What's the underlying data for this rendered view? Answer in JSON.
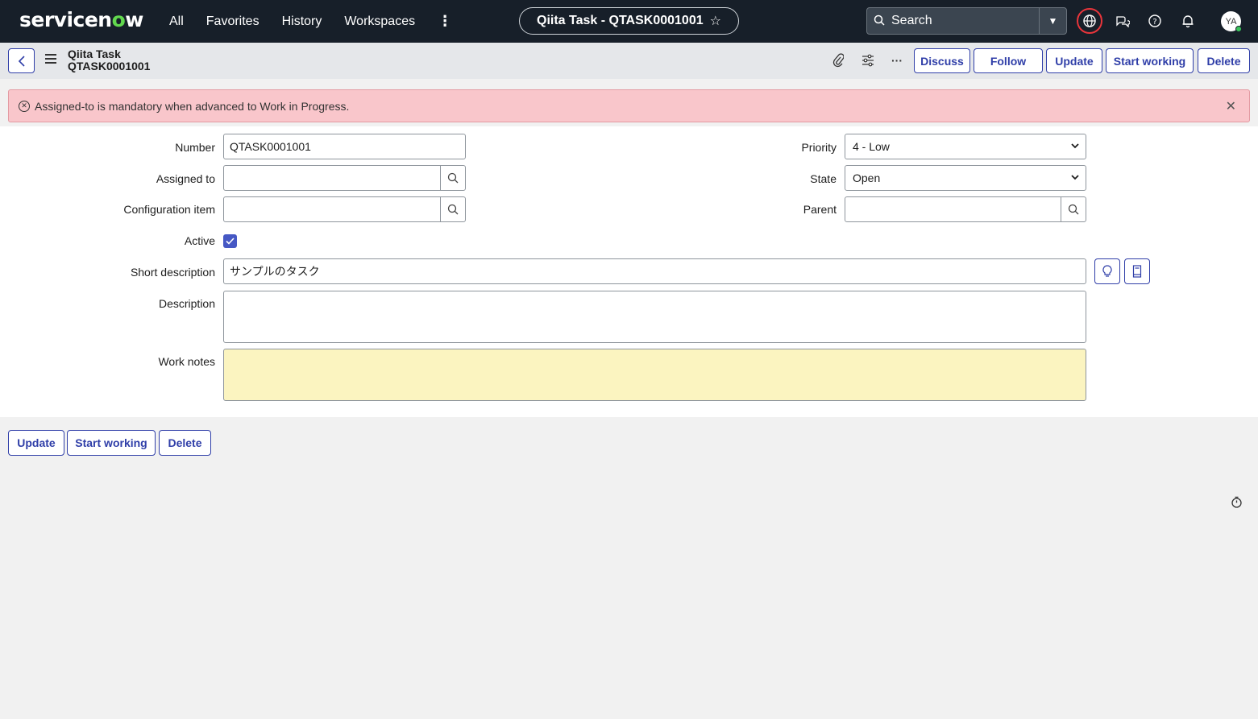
{
  "topnav": {
    "logo_prefix": "servicen",
    "logo_o": "o",
    "logo_suffix": "w",
    "links": [
      "All",
      "Favorites",
      "History",
      "Workspaces"
    ],
    "more_icon": "⋮",
    "context_title": "Qiita Task - QTASK0001001",
    "search_placeholder": "Search",
    "avatar_initials": "YA",
    "icons": [
      "globe-icon",
      "chat-icon",
      "help-icon",
      "bell-icon"
    ]
  },
  "form_header": {
    "table_label": "Qiita Task",
    "record_number": "QTASK0001001",
    "buttons": {
      "discuss": "Discuss",
      "follow": "Follow",
      "update": "Update",
      "start_working": "Start working",
      "delete": "Delete"
    },
    "icons": [
      "paperclip-icon",
      "settings-sliders-icon",
      "more-horizontal-icon"
    ]
  },
  "error": {
    "message": "Assigned-to is mandatory when advanced to Work in Progress."
  },
  "form": {
    "labels": {
      "number": "Number",
      "assigned_to": "Assigned to",
      "configuration_item": "Configuration item",
      "active": "Active",
      "short_description": "Short description",
      "description": "Description",
      "work_notes": "Work notes",
      "priority": "Priority",
      "state": "State",
      "parent": "Parent"
    },
    "values": {
      "number": "QTASK0001001",
      "assigned_to": "",
      "configuration_item": "",
      "active": true,
      "short_description": "サンプルのタスク",
      "description": "",
      "work_notes": "",
      "priority": "4 - Low",
      "state": "Open",
      "parent": ""
    }
  },
  "footer_buttons": {
    "update": "Update",
    "start_working": "Start working",
    "delete": "Delete"
  },
  "colors": {
    "nav_bg": "#171f29",
    "accent": "#2f3ea8",
    "error_bg": "#f9c6cb",
    "worknotes_bg": "#fbf4c0",
    "logo_accent": "#62d84e"
  }
}
